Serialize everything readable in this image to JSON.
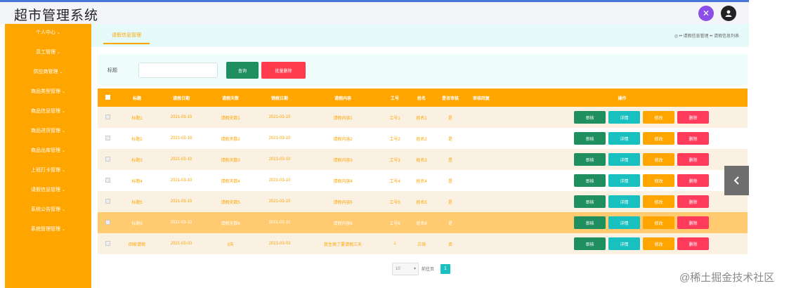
{
  "app": {
    "title": "超市管理系统"
  },
  "header_icons": [
    "close-icon",
    "user-avatar-icon"
  ],
  "sidebar": {
    "items": [
      {
        "label": "个人中心"
      },
      {
        "label": "员工管理"
      },
      {
        "label": "供应商管理"
      },
      {
        "label": "商品类型管理"
      },
      {
        "label": "商品信息管理"
      },
      {
        "label": "商品进货管理"
      },
      {
        "label": "商品出库管理"
      },
      {
        "label": "上班打卡管理"
      },
      {
        "label": "请假信息管理"
      },
      {
        "label": "系统公告管理"
      },
      {
        "label": "系统管理管理"
      }
    ]
  },
  "breadcrumb": {
    "active_tab": "请假信息管理",
    "path": "◎ •• 请假信息管理 •• 请假信息列表"
  },
  "search": {
    "label": "标题",
    "placeholder": "",
    "value": "",
    "query_label": "查询",
    "batch_delete_label": "批量删除"
  },
  "table": {
    "headers": [
      "标题",
      "请假日期",
      "请假天数",
      "销假日期",
      "请假内容",
      "工号",
      "姓名",
      "是否审核",
      "审核回复",
      "操作"
    ],
    "action_labels": {
      "review": "审核",
      "detail": "详情",
      "edit": "修改",
      "delete": "删除"
    },
    "rows": [
      {
        "title": "标题1",
        "leave_date": "2021-03-10",
        "days": "请假天数1",
        "return_date": "2021-03-10",
        "content": "请假内容1",
        "emp_no": "工号1",
        "name": "姓名1",
        "reviewed": "是",
        "reply": ""
      },
      {
        "title": "标题2",
        "leave_date": "2021-03-10",
        "days": "请假天数2",
        "return_date": "2021-03-10",
        "content": "请假内容2",
        "emp_no": "工号2",
        "name": "姓名2",
        "reviewed": "是",
        "reply": ""
      },
      {
        "title": "标题3",
        "leave_date": "2021-03-10",
        "days": "请假天数3",
        "return_date": "2021-03-10",
        "content": "请假内容3",
        "emp_no": "工号3",
        "name": "姓名3",
        "reviewed": "是",
        "reply": ""
      },
      {
        "title": "标题4",
        "leave_date": "2021-03-10",
        "days": "请假天数4",
        "return_date": "2021-03-10",
        "content": "请假内容4",
        "emp_no": "工号4",
        "name": "姓名4",
        "reviewed": "是",
        "reply": ""
      },
      {
        "title": "标题5",
        "leave_date": "2021-03-10",
        "days": "请假天数5",
        "return_date": "2021-03-10",
        "content": "请假内容5",
        "emp_no": "工号5",
        "name": "姓名5",
        "reviewed": "是",
        "reply": ""
      },
      {
        "title": "标题6",
        "leave_date": "2021-03-10",
        "days": "请假天数6",
        "return_date": "2021-03-10",
        "content": "请假内容6",
        "emp_no": "工号6",
        "name": "姓名6",
        "reviewed": "是",
        "reply": ""
      },
      {
        "title": "回家请假",
        "leave_date": "2021-03-03",
        "days": "3天",
        "return_date": "2021-03-03",
        "content": "我生病了要请假三天",
        "emp_no": "1",
        "name": "古琦",
        "reviewed": "否",
        "reply": ""
      }
    ],
    "highlighted_row": 5
  },
  "pager": {
    "page_size": "10",
    "goto_label": "前往页",
    "current_page": "1"
  },
  "watermark": "@稀土掘金技术社区",
  "colors": {
    "accent": "#ffa500",
    "teal": "#19c0c0",
    "green": "#1f8f5f",
    "red": "#ff3b4e",
    "header_bar": "#4a78d8"
  }
}
